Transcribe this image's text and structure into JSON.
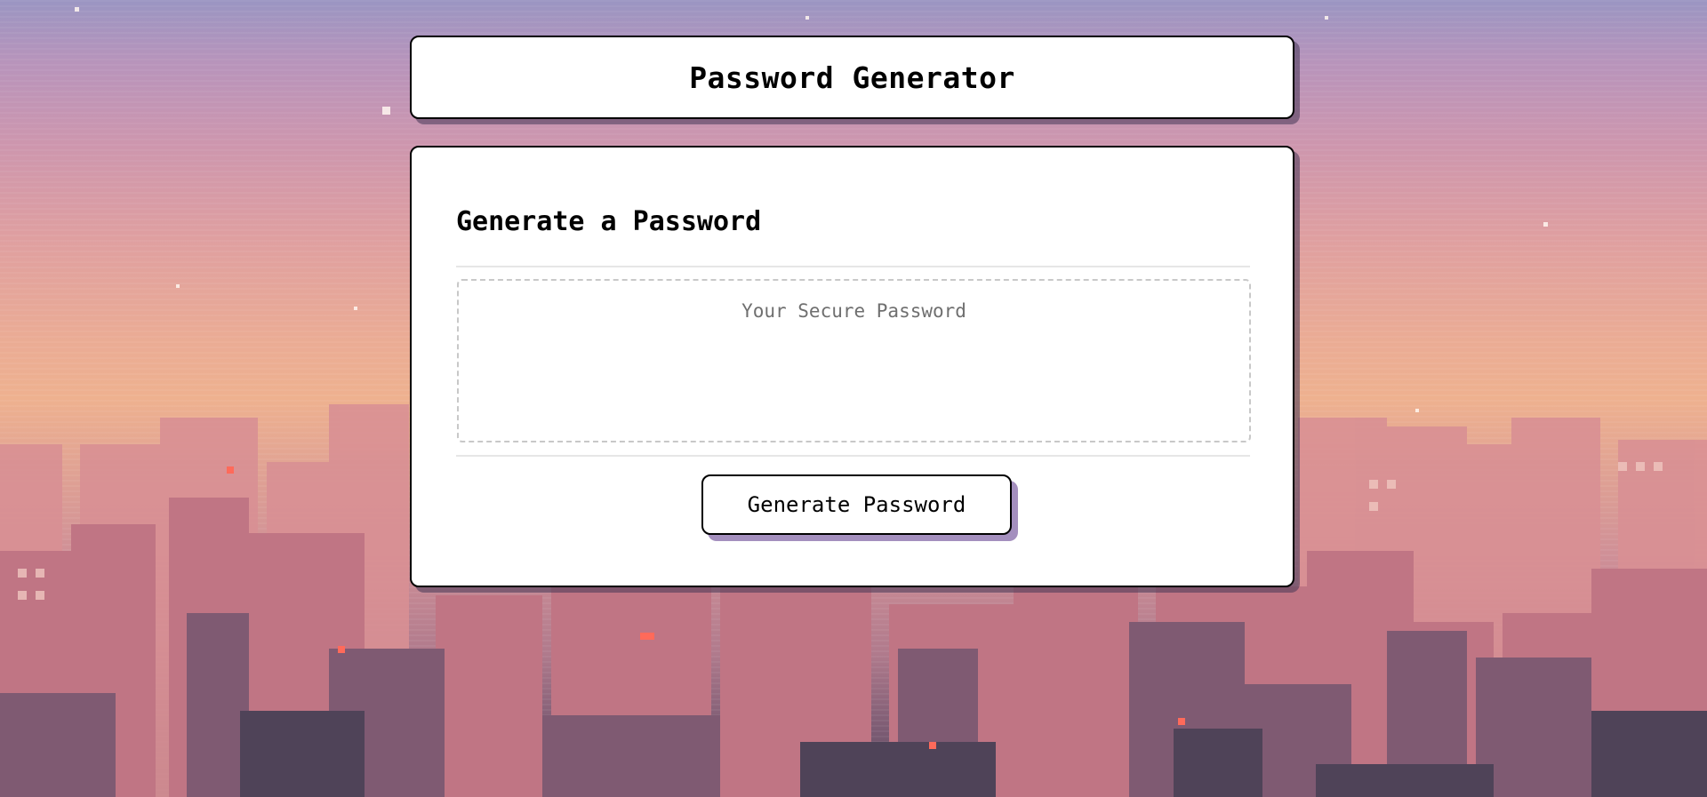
{
  "header": {
    "title": "Password Generator"
  },
  "card": {
    "heading": "Generate a Password",
    "password": {
      "value": "",
      "placeholder": "Your Secure Password"
    },
    "generate_label": "Generate Password"
  },
  "colors": {
    "card_background": "#ffffff",
    "border": "#000000",
    "button_shadow": "#a48fbe",
    "sky_top": "#9a95c2",
    "sky_horizon": "#eeb18f"
  }
}
